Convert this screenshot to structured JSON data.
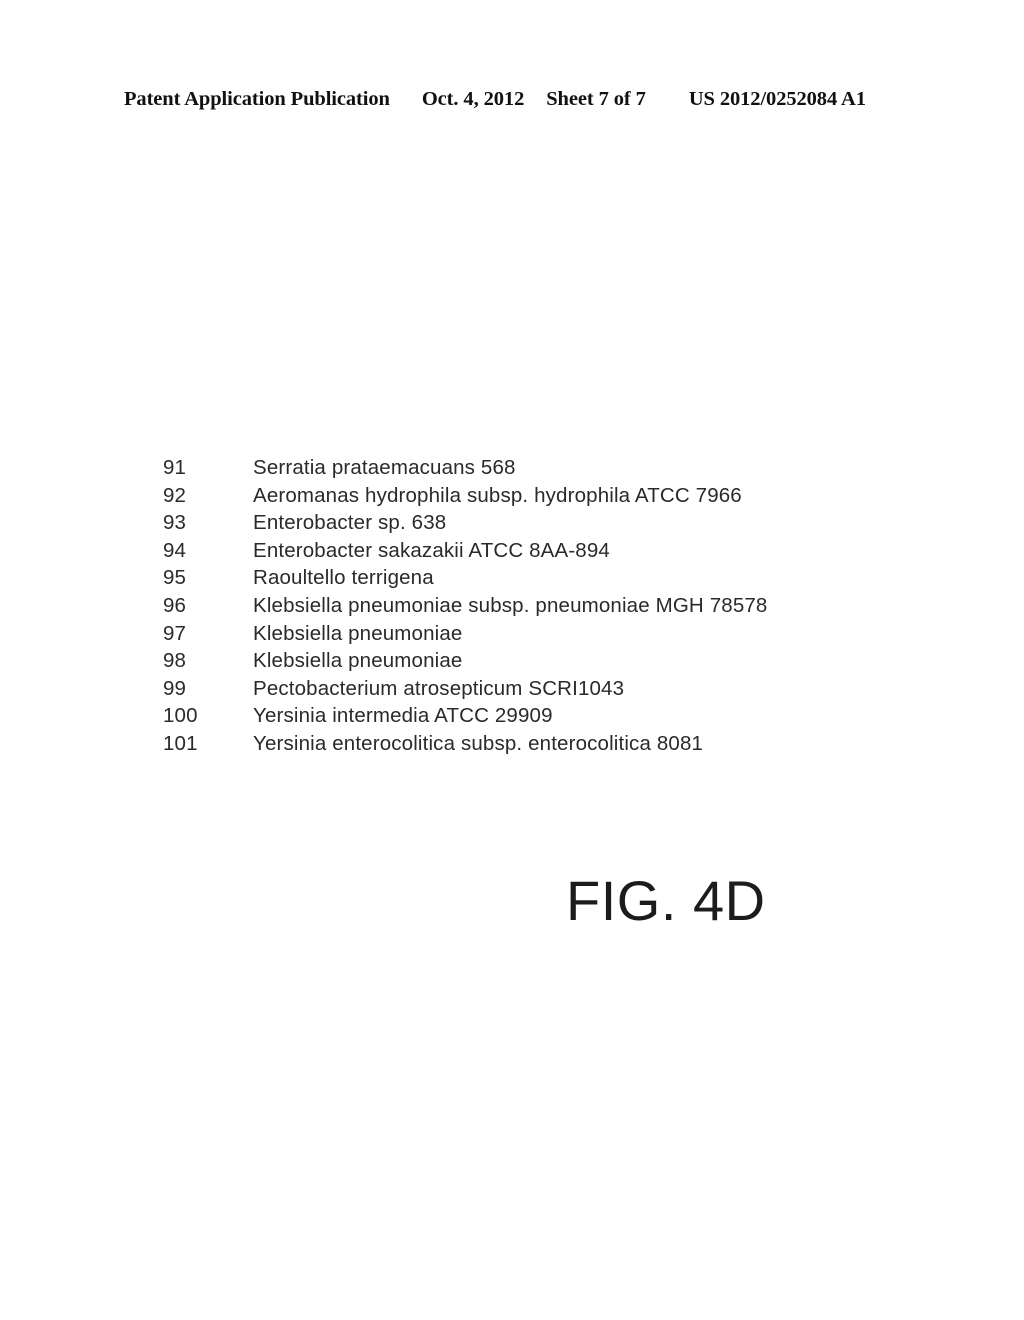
{
  "header": {
    "publication_label": "Patent Application Publication",
    "date": "Oct. 4, 2012",
    "sheet": "Sheet 7 of 7",
    "document_number": "US 2012/0252084 A1"
  },
  "figure": {
    "caption": "FIG. 4D",
    "entries": [
      {
        "index": "91",
        "name": "Serratia prataemacuans 568"
      },
      {
        "index": "92",
        "name": "Aeromanas hydrophila subsp. hydrophila ATCC 7966"
      },
      {
        "index": "93",
        "name": "Enterobacter sp. 638"
      },
      {
        "index": "94",
        "name": "Enterobacter sakazakii ATCC 8AA-894"
      },
      {
        "index": "95",
        "name": "Raoultello terrigena"
      },
      {
        "index": "96",
        "name": "Klebsiella pneumoniae subsp. pneumoniae MGH 78578"
      },
      {
        "index": "97",
        "name": "Klebsiella pneumoniae"
      },
      {
        "index": "98",
        "name": "Klebsiella pneumoniae"
      },
      {
        "index": "99",
        "name": "Pectobacterium atrosepticum SCRI1043"
      },
      {
        "index": "100",
        "name": "Yersinia intermedia ATCC 29909"
      },
      {
        "index": "101",
        "name": "Yersinia enterocolitica subsp. enterocolitica 8081"
      }
    ]
  }
}
